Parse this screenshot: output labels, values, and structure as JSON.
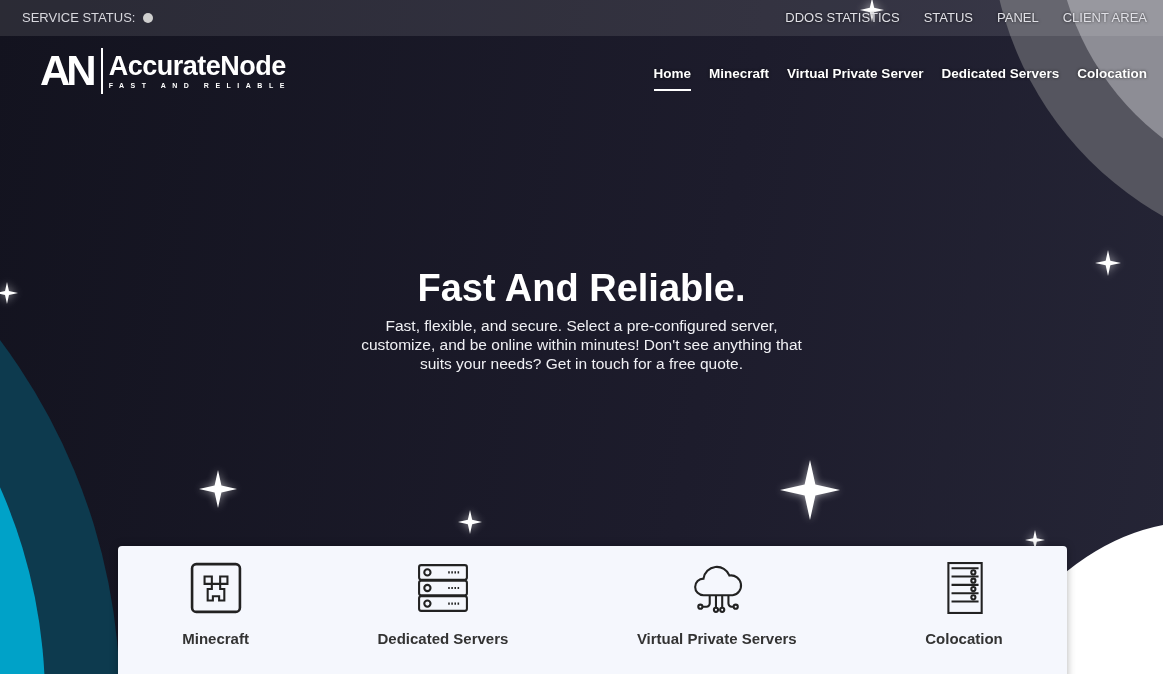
{
  "topbar": {
    "status_label": "SERVICE STATUS:",
    "status": {
      "color": "#cfcfcf"
    },
    "links": [
      "DDOS STATISTICS",
      "STATUS",
      "PANEL",
      "CLIENT AREA"
    ]
  },
  "logo": {
    "mark": "AN",
    "name": "AccurateNode",
    "tagline": "FAST AND RELIABLE"
  },
  "nav": [
    {
      "label": "Home",
      "selected": true
    },
    {
      "label": "Minecraft",
      "selected": false
    },
    {
      "label": "Virtual Private Server",
      "selected": false
    },
    {
      "label": "Dedicated Servers",
      "selected": false
    },
    {
      "label": "Colocation",
      "selected": false
    }
  ],
  "hero": {
    "title": "Fast And Reliable.",
    "text": "Fast, flexible, and secure. Select a pre-configured server, customize, and be online within minutes! Don't see anything that suits your needs? Get in touch for a free quote."
  },
  "services": [
    {
      "kind": "creeper",
      "label": "Minecraft"
    },
    {
      "kind": "server-stack",
      "label": "Dedicated Servers"
    },
    {
      "kind": "cloud",
      "label": "Virtual Private Servers"
    },
    {
      "kind": "rack",
      "label": "Colocation"
    }
  ]
}
